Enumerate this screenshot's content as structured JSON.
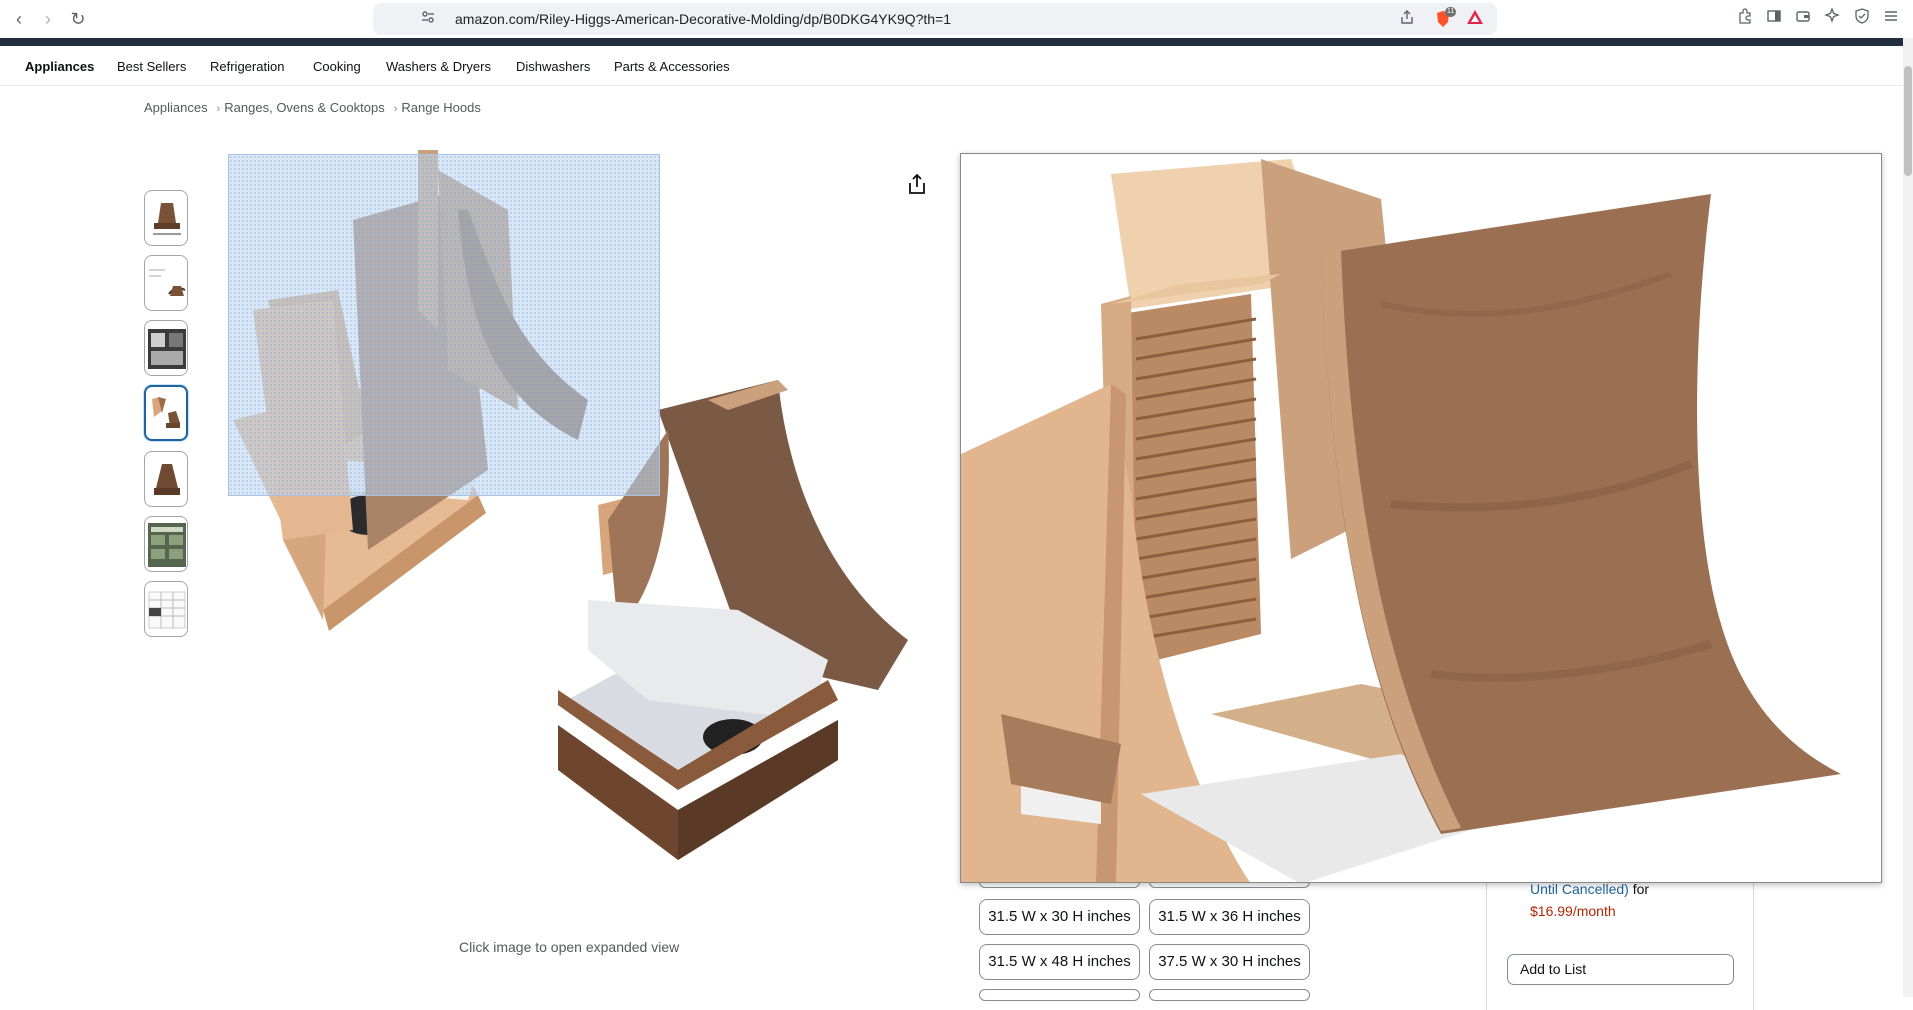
{
  "browser": {
    "url": "amazon.com/Riley-Higgs-American-Decorative-Molding/dp/B0DKG4YK9Q?th=1",
    "brave_badge_count": "11"
  },
  "subnav": {
    "items": [
      "Appliances",
      "Best Sellers",
      "Refrigeration",
      "Cooking",
      "Washers & Dryers",
      "Dishwashers",
      "Parts & Accessories"
    ]
  },
  "breadcrumb": [
    "Appliances",
    "Ranges, Ovens & Cooktops",
    "Range Hoods"
  ],
  "gallery": {
    "thumbnail_count": 7,
    "active_thumbnail": 4,
    "caption": "Click image to open expanded view"
  },
  "sizes": [
    "31.5 W x 30 H inches",
    "31.5 W x 36 H inches",
    "31.5 W x 48 H inches",
    "37.5 W x 30 H inches"
  ],
  "buybox": {
    "subscription_link": "Until Cancelled)",
    "subscription_for": "for",
    "subscription_price": "$16.99/month",
    "add_to_list": "Add to List"
  },
  "colors": {
    "nav_dark": "#232f3e",
    "link": "#2162a1",
    "price": "#b12704",
    "wood_light": "#e2b48a",
    "wood_dark": "#8a5a3c"
  }
}
